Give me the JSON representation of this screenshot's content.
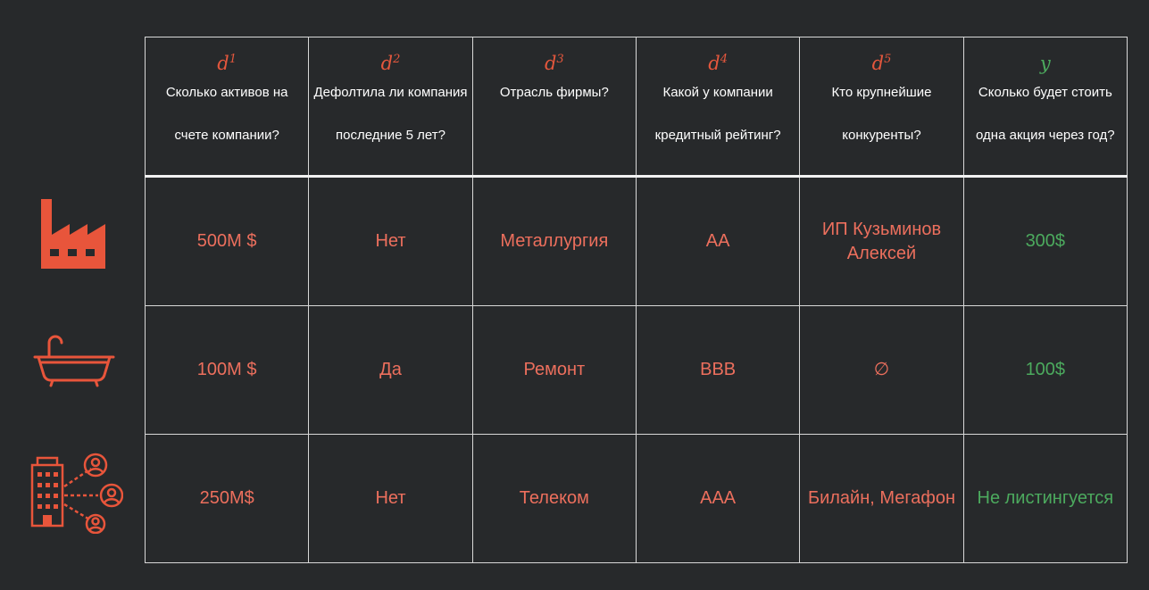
{
  "header": {
    "columns": [
      {
        "var_base": "d",
        "var_sup": "1",
        "question": "Сколько активов на\nсчете компании?"
      },
      {
        "var_base": "d",
        "var_sup": "2",
        "question": "Дефолтила ли компания\nпоследние 5 лет?"
      },
      {
        "var_base": "d",
        "var_sup": "3",
        "question": "Отрасль фирмы?"
      },
      {
        "var_base": "d",
        "var_sup": "4",
        "question": "Какой у компании\nкредитный рейтинг?"
      },
      {
        "var_base": "d",
        "var_sup": "5",
        "question": "Кто крупнейшие\nконкуренты?"
      },
      {
        "var_base": "y",
        "var_sup": "",
        "question": "Сколько будет стоить\nодна акция через год?"
      }
    ]
  },
  "rows": [
    {
      "icon": "factory-icon",
      "cells": [
        "500M $",
        "Нет",
        "Металлургия",
        "AA",
        "ИП Кузьминов\nАлексей",
        "300$"
      ]
    },
    {
      "icon": "bathtub-icon",
      "cells": [
        "100M $",
        "Да",
        "Ремонт",
        "BBB",
        "∅",
        "100$"
      ]
    },
    {
      "icon": "office-network-icon",
      "cells": [
        "250M$",
        "Нет",
        "Телеком",
        "AAA",
        "Билайн, Мегафон",
        "Не листингуется"
      ]
    }
  ],
  "colors": {
    "background": "#27292b",
    "feature_text": "#ec6f5d",
    "feature_var": "#e4573d",
    "target": "#4caa5e",
    "icon": "#e8553b"
  }
}
